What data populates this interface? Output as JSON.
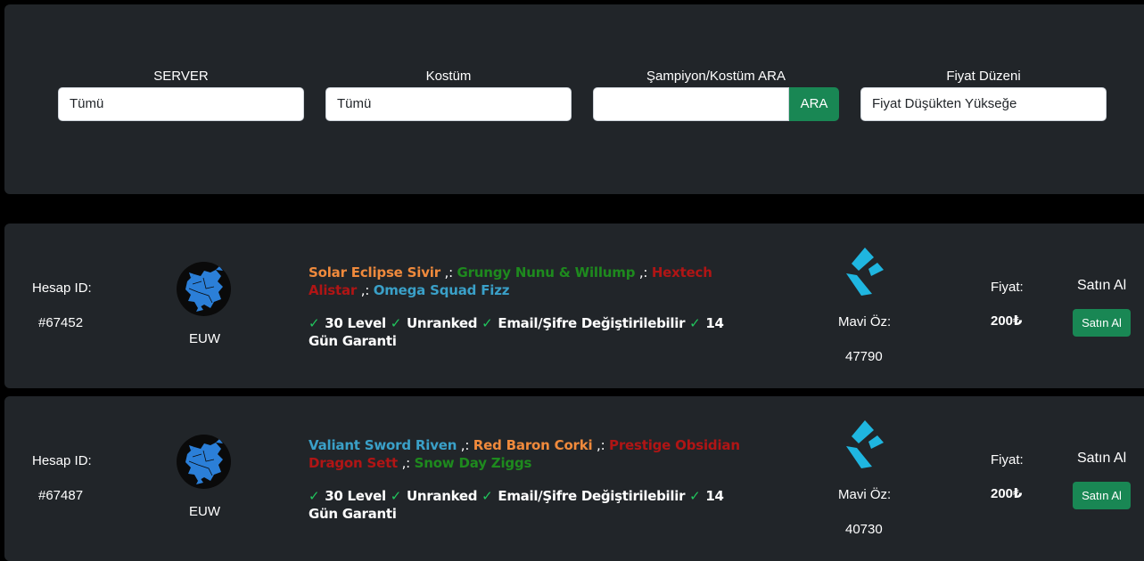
{
  "filters": [
    {
      "label": "SERVER",
      "value": "Tümü"
    },
    {
      "label": "Kostüm",
      "value": "Tümü"
    },
    {
      "label": "Şampiyon/Kostüm ARA",
      "value": "",
      "button": "ARA"
    },
    {
      "label": "Fiyat Düzeni",
      "value": "Fiyat Düşükten Yükseğe"
    }
  ],
  "listings": [
    {
      "id_label": "Hesap ID:",
      "id": "#67452",
      "server": "EUW",
      "skins": [
        {
          "name": "Solar Eclipse Sivir",
          "color": "#f08a3c"
        },
        {
          "name": "Grungy Nunu & Willump",
          "color": "#1e8a1e"
        },
        {
          "name": "Hextech Alistar",
          "color": "#b01515"
        },
        {
          "name": "Omega Squad Fizz",
          "color": "#3aa0c8"
        }
      ],
      "separator": " ,: ",
      "features": [
        "30 Level",
        "Unranked",
        "Email/Şifre Değiştirilebilir",
        "14 Gün Garanti"
      ],
      "essence_label": "Mavi Öz:",
      "essence": "47790",
      "price_label": "Fiyat:",
      "price": "200₺",
      "buy_title": "Satın Al",
      "buy_button": "Satın Al"
    },
    {
      "id_label": "Hesap ID:",
      "id": "#67487",
      "server": "EUW",
      "skins": [
        {
          "name": "Valiant Sword Riven",
          "color": "#3aa0c8"
        },
        {
          "name": "Red Baron Corki",
          "color": "#f08a3c"
        },
        {
          "name": "Prestige Obsidian Dragon Sett",
          "color": "#b01515"
        },
        {
          "name": "Snow Day Ziggs",
          "color": "#1e8a1e"
        }
      ],
      "separator": " ,: ",
      "features": [
        "30 Level",
        "Unranked",
        "Email/Şifre Değiştirilebilir",
        "14 Gün Garanti"
      ],
      "essence_label": "Mavi Öz:",
      "essence": "40730",
      "price_label": "Fiyat:",
      "price": "200₺",
      "buy_title": "Satın Al",
      "buy_button": "Satın Al"
    }
  ],
  "icons": {
    "check": "check-icon",
    "globe": "europe-globe-icon",
    "essence": "blue-essence-icon"
  }
}
